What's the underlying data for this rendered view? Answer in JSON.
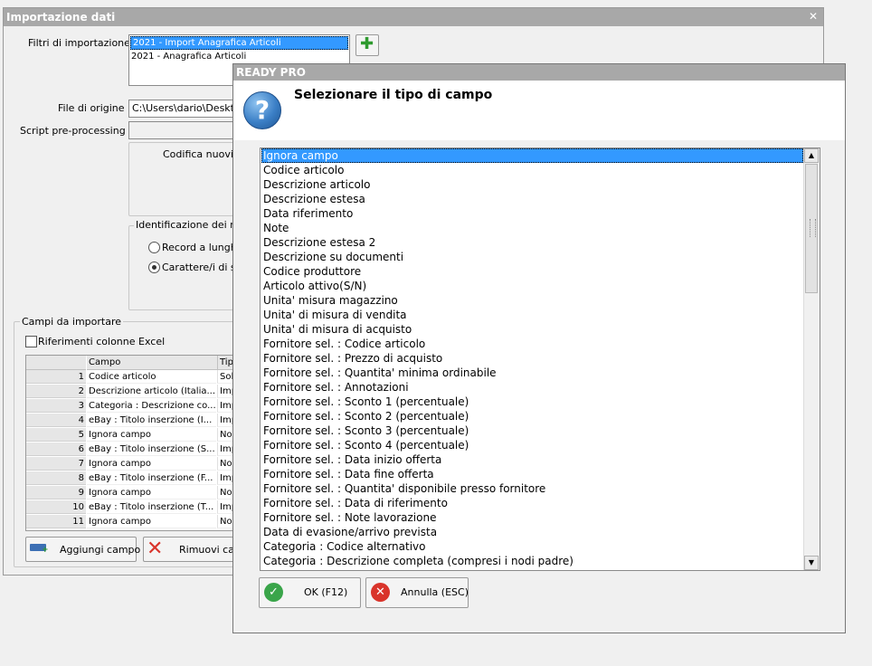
{
  "back_window": {
    "title": "Importazione dati",
    "close_glyph": "✕",
    "filters_label": "Filtri di importazione :",
    "filters": [
      "2021 - Import Anagrafica Articoli",
      "2021 - Anagrafica Articoli"
    ],
    "source_file_label": "File di origine :",
    "source_file_value": "C:\\Users\\dario\\Desktop",
    "script_label": "Script pre-processing :",
    "script_value": "",
    "codifica_label": "Codifica nuovi a",
    "identification_group_label": "Identificazione dei reco",
    "radio_fixed_label": "Record a lunghe",
    "radio_sep_label": "Carattere/i di sep",
    "fields_group_label": "Campi da importare",
    "excel_refs_label": "Riferimenti colonne Excel",
    "grid": {
      "headers": [
        "Campo",
        "Tipo"
      ],
      "rows": [
        {
          "n": "1",
          "campo": "Codice articolo",
          "tipo": "Solo"
        },
        {
          "n": "2",
          "campo": "Descrizione articolo (Italia...",
          "tipo": "Imp"
        },
        {
          "n": "3",
          "campo": "Categoria : Descrizione co...",
          "tipo": "Imp"
        },
        {
          "n": "4",
          "campo": "eBay : Titolo inserzione (I...",
          "tipo": "Imp"
        },
        {
          "n": "5",
          "campo": "Ignora campo",
          "tipo": "Nor"
        },
        {
          "n": "6",
          "campo": "eBay : Titolo inserzione (S...",
          "tipo": "Imp"
        },
        {
          "n": "7",
          "campo": "Ignora campo",
          "tipo": "Nor"
        },
        {
          "n": "8",
          "campo": "eBay : Titolo inserzione (F...",
          "tipo": "Imp"
        },
        {
          "n": "9",
          "campo": "Ignora campo",
          "tipo": "Nor"
        },
        {
          "n": "10",
          "campo": "eBay : Titolo inserzione (T...",
          "tipo": "Imp"
        },
        {
          "n": "11",
          "campo": "Ignora campo",
          "tipo": "Nor"
        }
      ]
    },
    "add_field_button": "Aggiungi campo",
    "remove_field_button": "Rimuovi cam"
  },
  "dialog": {
    "title": "READY PRO",
    "heading": "Selezionare il tipo di campo",
    "question_glyph": "?",
    "selected_index": 0,
    "options": [
      "Ignora campo",
      "Codice articolo",
      "Descrizione articolo",
      "Descrizione estesa",
      "Data riferimento",
      "Note",
      "Descrizione estesa 2",
      "Descrizione su documenti",
      "Codice produttore",
      "Articolo attivo(S/N)",
      "Unita' misura magazzino",
      "Unita' di misura di vendita",
      "Unita' di misura di acquisto",
      "Fornitore sel. : Codice articolo",
      "Fornitore sel. : Prezzo di acquisto",
      "Fornitore sel. : Quantita' minima ordinabile",
      "Fornitore sel. : Annotazioni",
      "Fornitore sel. : Sconto 1 (percentuale)",
      "Fornitore sel. : Sconto 2 (percentuale)",
      "Fornitore sel. : Sconto 3 (percentuale)",
      "Fornitore sel. : Sconto 4 (percentuale)",
      "Fornitore sel. : Data inizio offerta",
      "Fornitore sel. : Data fine offerta",
      "Fornitore sel. : Quantita' disponibile presso fornitore",
      "Fornitore sel. : Data di riferimento",
      "Fornitore sel. : Note lavorazione",
      "Data di evasione/arrivo prevista",
      "Categoria : Codice alternativo",
      "Categoria : Descrizione completa (compresi i nodi padre)"
    ],
    "scroll_up_glyph": "▲",
    "scroll_down_glyph": "▼",
    "ok_button": "OK (F12)",
    "cancel_button": "Annulla (ESC)",
    "ok_glyph": "✓",
    "cancel_glyph": "✕"
  },
  "colors": {
    "selection": "#3399ff",
    "titlebar": "#a8a8a8",
    "ok_icon": "#3aa54a",
    "cancel_icon": "#d9342b",
    "plus_icon": "#2f9a2f"
  },
  "icons": [
    "close-icon",
    "add-filter-plus-icon",
    "question-icon",
    "ok-check-icon",
    "cancel-x-icon",
    "add-field-icon",
    "remove-field-x-icon"
  ]
}
